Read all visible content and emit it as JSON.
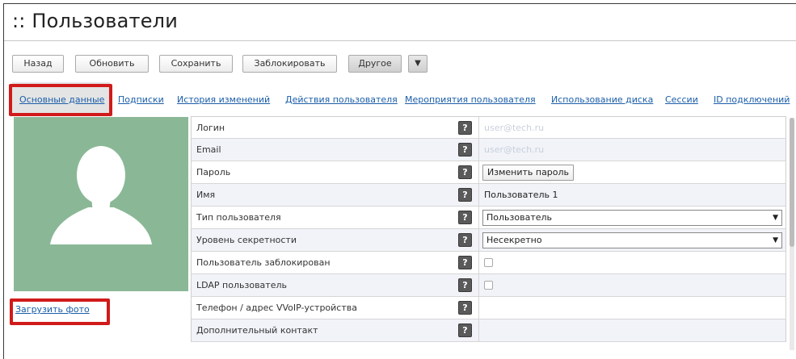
{
  "page": {
    "title": ":: Пользователи"
  },
  "toolbar": {
    "back": "Назад",
    "refresh": "Обновить",
    "save": "Сохранить",
    "block": "Заблокировать",
    "other": "Другое",
    "dropdown_arrow": "▼"
  },
  "tabs": [
    "Основные данные",
    "Подписки",
    "История изменений",
    "Действия пользователя",
    "Мероприятия пользователя",
    "Использование диска",
    "Сессии",
    "ID подключений"
  ],
  "photo": {
    "icon": "user-silhouette-icon",
    "upload_label": "Загрузить фото"
  },
  "fields": {
    "login": {
      "label": "Логин",
      "value": "user@tech.ru"
    },
    "email": {
      "label": "Email",
      "value": "user@tech.ru"
    },
    "password": {
      "label": "Пароль",
      "button": "Изменить пароль"
    },
    "name": {
      "label": "Имя",
      "value": "Пользователь 1"
    },
    "user_type": {
      "label": "Тип пользователя",
      "value": "Пользователь"
    },
    "secrecy": {
      "label": "Уровень секретности",
      "value": "Несекретно"
    },
    "blocked": {
      "label": "Пользователь заблокирован",
      "checked": false
    },
    "ldap": {
      "label": "LDAP пользователь",
      "checked": false
    },
    "phone": {
      "label": "Телефон / адрес VVoIP-устройства",
      "value": ""
    },
    "extra_contact": {
      "label": "Дополнительный контакт",
      "value": ""
    }
  },
  "help_glyph": "?",
  "colors": {
    "accent_link": "#1a5ea8",
    "highlight_red": "#d11a1a",
    "photo_bg": "#8ab896",
    "alt_row": "#f1f3f8"
  }
}
